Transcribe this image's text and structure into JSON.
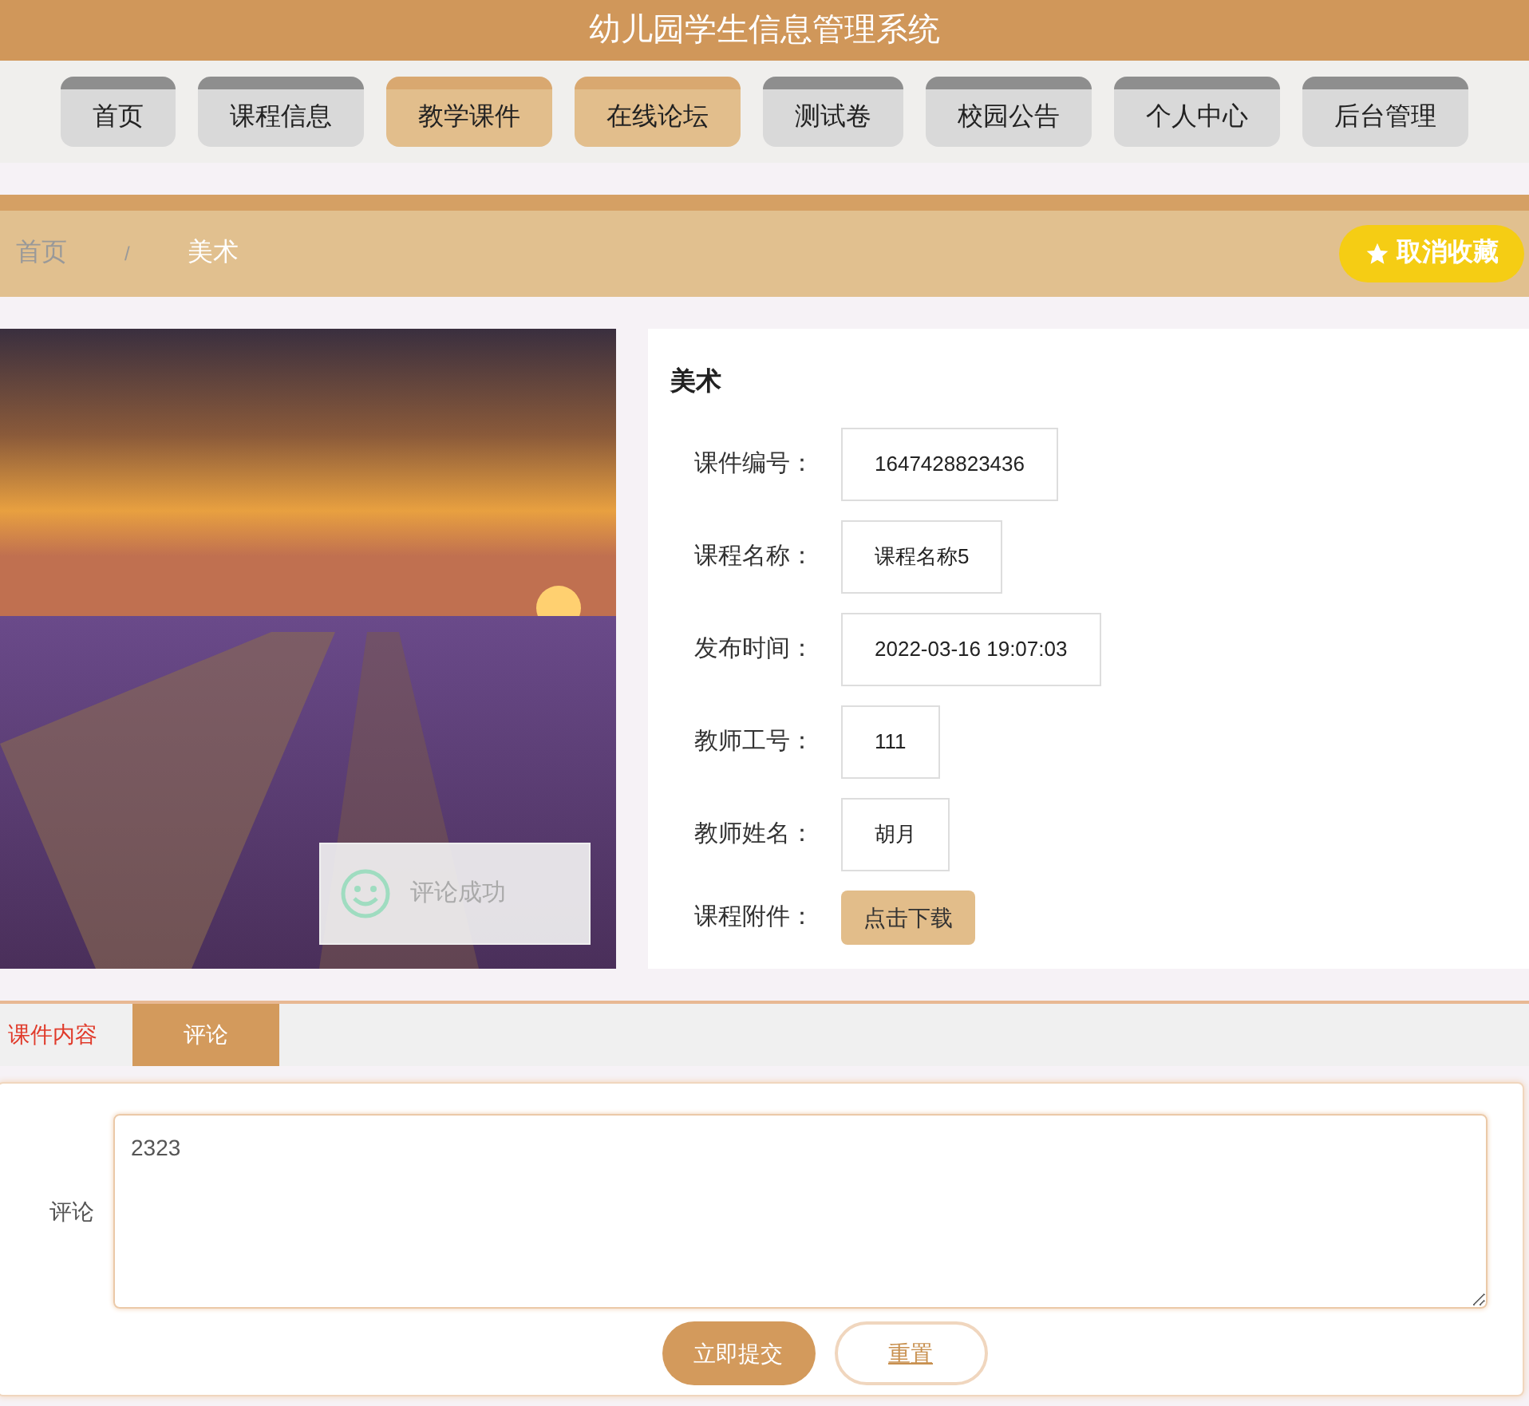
{
  "header": {
    "title": "幼儿园学生信息管理系统"
  },
  "nav": [
    {
      "label": "首页",
      "selected": false
    },
    {
      "label": "课程信息",
      "selected": false
    },
    {
      "label": "教学课件",
      "selected": true
    },
    {
      "label": "在线论坛",
      "selected": true
    },
    {
      "label": "测试卷",
      "selected": false
    },
    {
      "label": "校园公告",
      "selected": false
    },
    {
      "label": "个人中心",
      "selected": false
    },
    {
      "label": "后台管理",
      "selected": false
    }
  ],
  "breadcrumb": {
    "items": [
      "首页",
      "美术"
    ],
    "separator": "/"
  },
  "favorite_button": {
    "label": "取消收藏"
  },
  "detail": {
    "title": "美术",
    "fields": [
      {
        "kind": "value",
        "label": "课件编号：",
        "value": "1647428823436"
      },
      {
        "kind": "value",
        "label": "课程名称：",
        "value": "课程名称5"
      },
      {
        "kind": "value",
        "label": "发布时间：",
        "value": "2022-03-16 19:07:03"
      },
      {
        "kind": "value",
        "label": "教师工号：",
        "value": "111"
      },
      {
        "kind": "value",
        "label": "教师姓名：",
        "value": "胡月"
      },
      {
        "kind": "button",
        "label": "课程附件：",
        "value": "点击下载"
      }
    ]
  },
  "toast": {
    "message": "评论成功"
  },
  "tabs": [
    {
      "label": "课件内容",
      "selected": false
    },
    {
      "label": "评论",
      "selected": true
    }
  ],
  "comment_form": {
    "label": "评论",
    "value": "2323",
    "buttons": [
      {
        "kind": "primary",
        "label": "立即提交"
      },
      {
        "kind": "secondary",
        "label": "重置"
      }
    ]
  }
}
